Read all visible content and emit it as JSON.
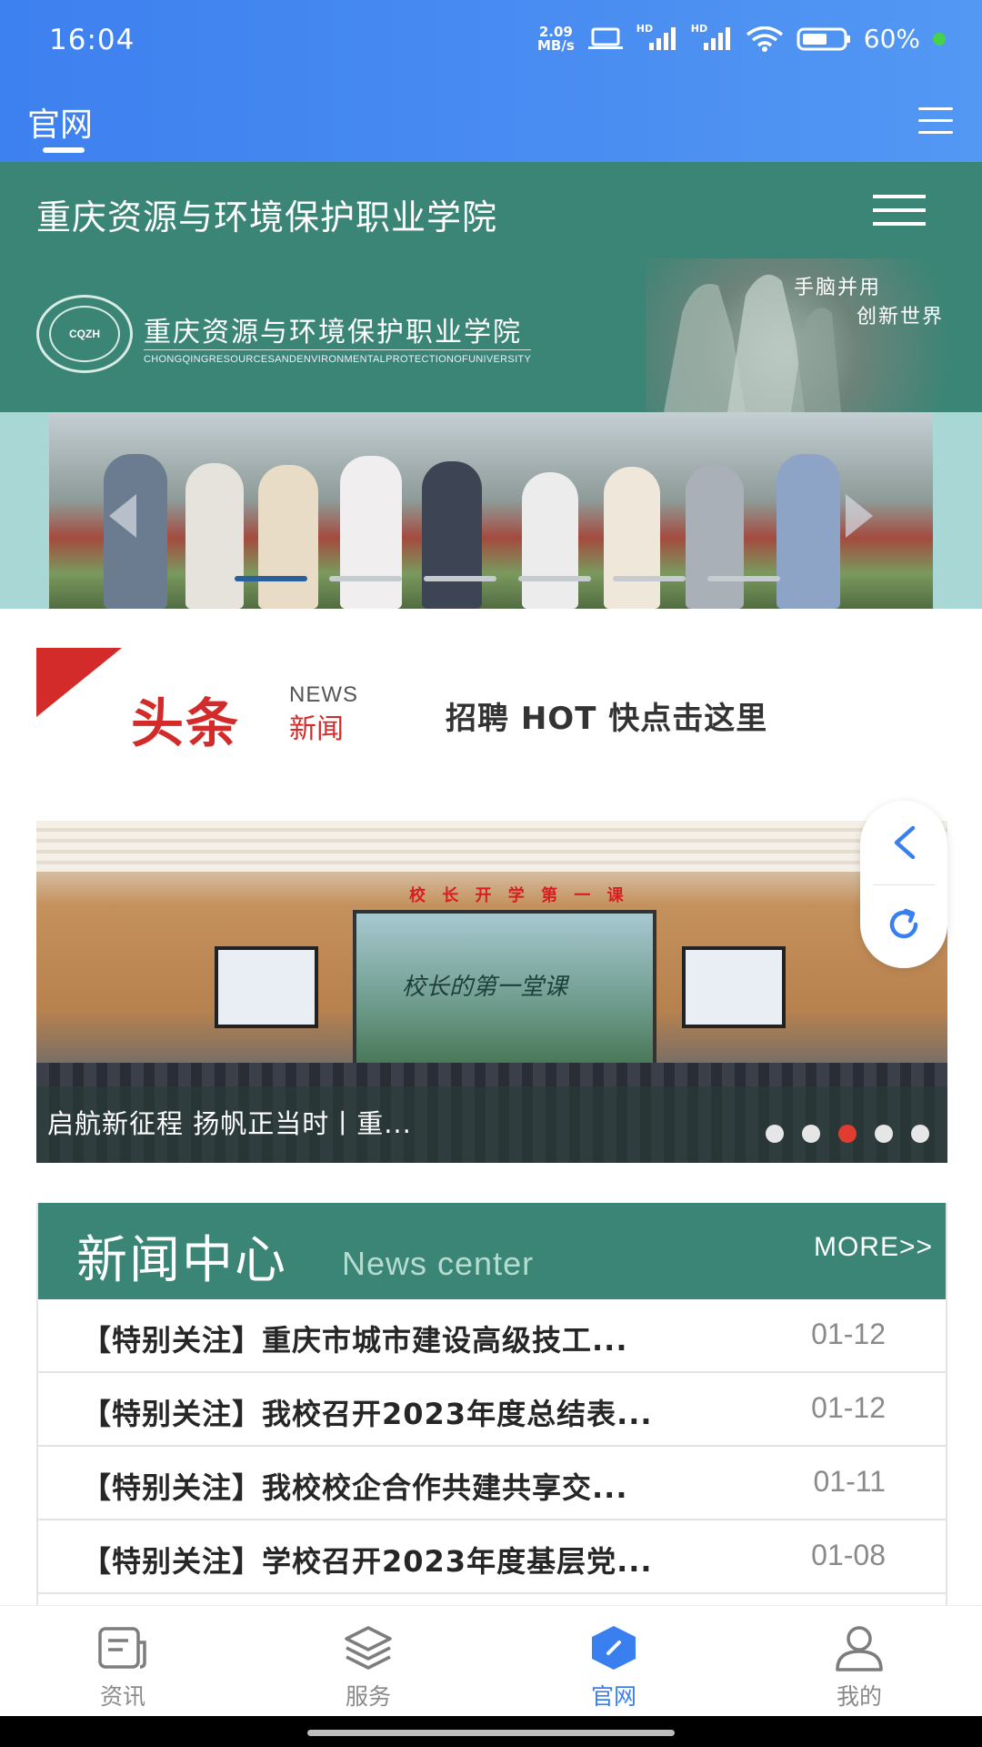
{
  "status_bar": {
    "time": "16:04",
    "net_speed_value": "2.09",
    "net_speed_unit": "MB/s",
    "hd_label_1": "HD",
    "hd_label_2": "HD",
    "battery": "60%"
  },
  "app_header": {
    "tab_label": "官网"
  },
  "web_header": {
    "title": "重庆资源与环境保护职业学院",
    "logo_cn": "重庆资源与环境保护职业学院",
    "logo_en": "CHONGQINGRESOURCESANDENVIRONMENTALPROTECTIONOFUNIVERSITY",
    "logo_abbr": "CQZH",
    "slogan_1": "手脑并用",
    "slogan_2": "创新世界"
  },
  "banner": {
    "dot_count": 6,
    "active_dot": 0
  },
  "headline": {
    "brand_big": "头条",
    "brand_news": "NEWS",
    "brand_xinwen": "新闻",
    "hot_link": "招聘 HOT 快点击这里"
  },
  "news_slider": {
    "stage_banner": "校 长 开 学 第 一 课",
    "screen_text": "校长的第一堂课",
    "caption": "启航新征程 扬帆正当时丨重...",
    "dot_count": 5,
    "active_dot": 2
  },
  "news_center": {
    "title": "新闻中心",
    "subtitle": "News center",
    "more": "MORE>>",
    "items": [
      {
        "title": "【特别关注】重庆市城市建设高级技工...",
        "date": "01-12"
      },
      {
        "title": "【特别关注】我校召开2023年度总结表...",
        "date": "01-12"
      },
      {
        "title": "【特别关注】我校校企合作共建共享交...",
        "date": "01-11"
      },
      {
        "title": "【特别关注】学校召开2023年度基层党...",
        "date": "01-08"
      }
    ]
  },
  "bottom_nav": {
    "items": [
      {
        "label": "资讯",
        "icon": "news-icon"
      },
      {
        "label": "服务",
        "icon": "layers-icon"
      },
      {
        "label": "官网",
        "icon": "compass-icon"
      },
      {
        "label": "我的",
        "icon": "user-icon"
      }
    ],
    "active_index": 2
  },
  "colors": {
    "app_blue": "#4a8df2",
    "school_green": "#3a8575",
    "accent_red": "#d32a2a",
    "active_nav": "#3a7ff0"
  }
}
